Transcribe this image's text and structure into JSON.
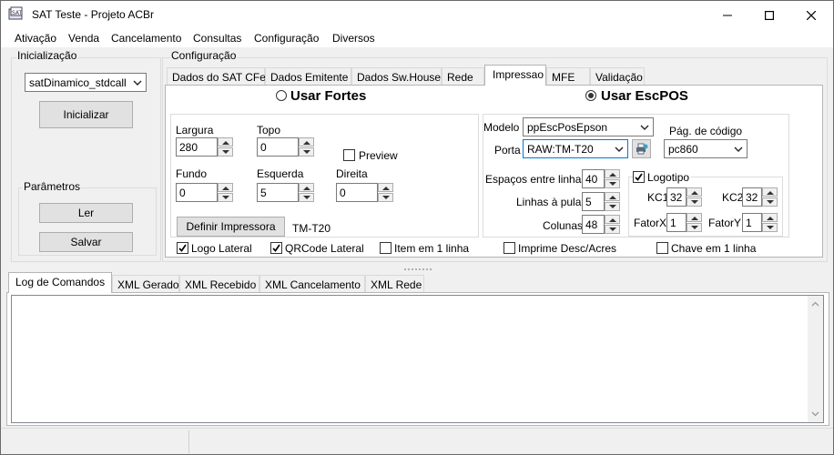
{
  "window": {
    "title": "SAT Teste - Projeto ACBr"
  },
  "title_buttons": {
    "minimize": "minimize-icon",
    "maximize": "maximize-icon",
    "close": "close-icon"
  },
  "menu": [
    "Ativação",
    "Venda",
    "Cancelamento",
    "Consultas",
    "Configuração",
    "Diversos"
  ],
  "init_group": {
    "label": "Inicialização",
    "lib_value": "satDinamico_stdcall",
    "init_button": "Inicializar"
  },
  "params_group": {
    "label": "Parâmetros",
    "read_button": "Ler",
    "save_button": "Salvar"
  },
  "config_group": {
    "label": "Configuração",
    "tabs": [
      "Dados do SAT CFe",
      "Dados Emitente",
      "Dados Sw.House",
      "Rede",
      "Impressao",
      "MFE",
      "Validação"
    ],
    "active_tab": "Impressao"
  },
  "impressao": {
    "radio_fortes": "Usar Fortes",
    "radio_escpos": "Usar EscPOS",
    "selected": "Usar EscPOS",
    "fortes": {
      "largura_label": "Largura",
      "largura_value": "280",
      "topo_label": "Topo",
      "topo_value": "0",
      "preview_label": "Preview",
      "preview_checked": false,
      "fundo_label": "Fundo",
      "fundo_value": "0",
      "esquerda_label": "Esquerda",
      "esquerda_value": "5",
      "direita_label": "Direita",
      "direita_value": "0",
      "definir_button": "Definir Impressora",
      "printer_name": "TM-T20"
    },
    "escpos": {
      "modelo_label": "Modelo",
      "modelo_value": "ppEscPosEpson",
      "porta_label": "Porta",
      "porta_value": "RAW:TM-T20",
      "pagcodigo_label": "Pág. de código",
      "pagcodigo_value": "pc860",
      "espacos_label": "Espaços entre linhas",
      "espacos_value": "40",
      "linhas_label": "Linhas à pular",
      "linhas_value": "5",
      "colunas_label": "Colunas",
      "colunas_value": "48",
      "logotipo_label": "Logotipo",
      "logotipo_checked": true,
      "kc1_label": "KC1",
      "kc1_value": "32",
      "kc2_label": "KC2",
      "kc2_value": "32",
      "fatorx_label": "FatorX",
      "fatorx_value": "1",
      "fatory_label": "FatorY",
      "fatory_value": "1"
    },
    "checks": [
      {
        "label": "Logo Lateral",
        "checked": true
      },
      {
        "label": "QRCode Lateral",
        "checked": true
      },
      {
        "label": "Item em 1 linha",
        "checked": false
      },
      {
        "label": "Imprime Desc/Acres",
        "checked": false
      },
      {
        "label": "Chave em 1 linha",
        "checked": false
      }
    ]
  },
  "log_tabs": [
    "Log de Comandos",
    "XML Gerado",
    "XML Recebido",
    "XML Cancelamento",
    "XML Rede"
  ],
  "log_active": "Log de Comandos"
}
